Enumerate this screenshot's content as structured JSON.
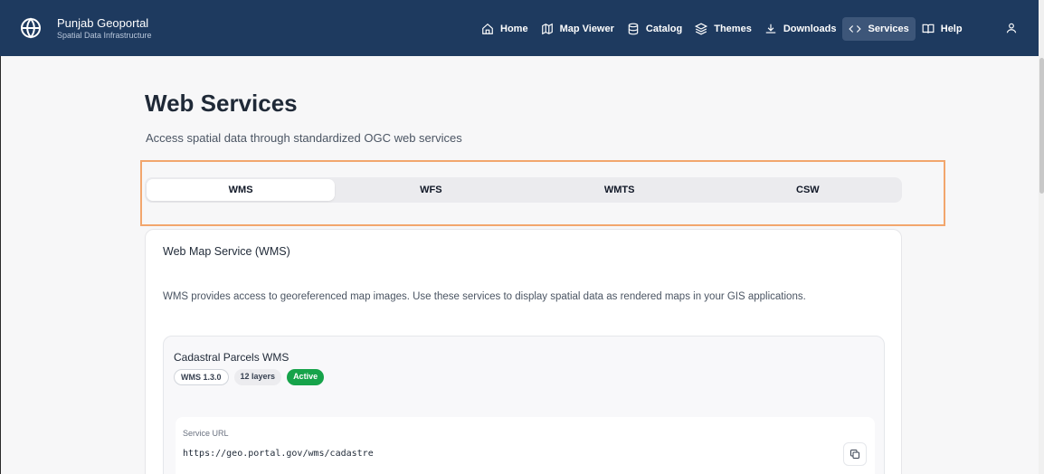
{
  "brand": {
    "title": "Punjab Geoportal",
    "subtitle": "Spatial Data Infrastructure"
  },
  "nav": {
    "items": [
      {
        "label": "Home",
        "icon": "home-icon"
      },
      {
        "label": "Map Viewer",
        "icon": "map-icon"
      },
      {
        "label": "Catalog",
        "icon": "database-icon"
      },
      {
        "label": "Themes",
        "icon": "layers-icon"
      },
      {
        "label": "Downloads",
        "icon": "download-icon"
      },
      {
        "label": "Services",
        "icon": "code-icon",
        "active": true
      },
      {
        "label": "Help",
        "icon": "book-icon"
      }
    ],
    "user_icon": "user-icon"
  },
  "page": {
    "title": "Web Services",
    "subtitle": "Access spatial data through standardized OGC web services"
  },
  "tabs": [
    {
      "label": "WMS",
      "active": true
    },
    {
      "label": "WFS"
    },
    {
      "label": "WMTS"
    },
    {
      "label": "CSW"
    }
  ],
  "card": {
    "title": "Web Map Service (WMS)",
    "description": "WMS provides access to georeferenced map images. Use these services to display spatial data as rendered maps in your GIS applications."
  },
  "service": {
    "title": "Cadastral Parcels WMS",
    "badges": [
      "WMS 1.3.0",
      "12 layers",
      "Active"
    ],
    "url_label": "Service URL",
    "url": "https://geo.portal.gov/wms/cadastre",
    "copy_icon": "copy-icon"
  },
  "colors": {
    "header": "#1e3a5f",
    "active_badge": "#16a34a",
    "highlight": "#f2a66d"
  }
}
